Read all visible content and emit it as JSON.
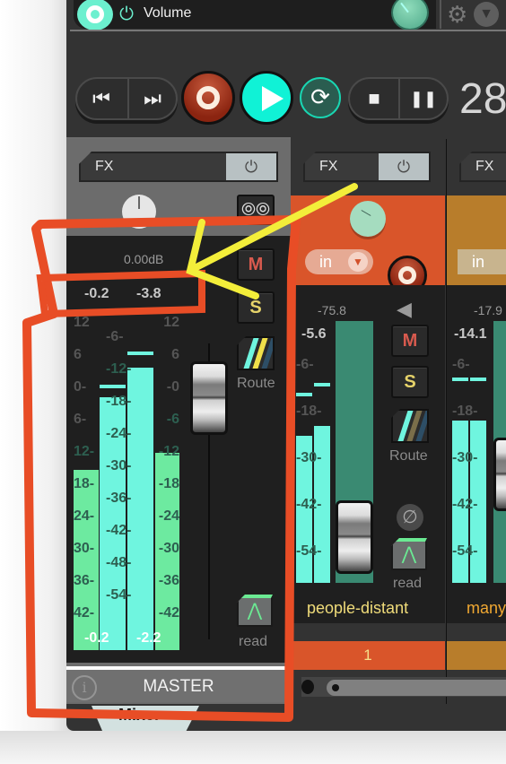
{
  "plugin": {
    "name": "Volume",
    "power_icon": "⏻",
    "gear_icon": "⚙",
    "dropdown_icon": "▼"
  },
  "transport": {
    "prev_icon": "⏮",
    "next_icon": "⏭",
    "record_icon": "record",
    "play_icon": "play",
    "loop_icon": "⟳",
    "stop_icon": "■",
    "pause_icon": "❚❚",
    "counter": "28"
  },
  "master": {
    "fx_label": "FX",
    "fx_power_icon": "⏻",
    "stereo_icon": "⦾⦾",
    "volume_db": "0.00dB",
    "peak_left": "-0.2",
    "peak_right": "-3.8",
    "mute_label": "M",
    "solo_label": "S",
    "route_label": "Route",
    "automation_label": "read",
    "automation_icon": "⋀",
    "name": "MASTER",
    "info_icon": "i",
    "meter_bottom_left": "-0.2",
    "meter_bottom_right": "-2.2",
    "scale_outer_left": [
      "12",
      "6",
      "0-",
      "6-",
      "12-",
      "18-",
      "24-",
      "30-",
      "36-",
      "42-"
    ],
    "scale_outer_right": [
      "12",
      "6",
      "-0",
      "-6",
      "-12",
      "-18",
      "-24",
      "-30",
      "-36",
      "-42"
    ],
    "scale_center": [
      "-6-",
      "-12-",
      "-18-",
      "-24-",
      "-30-",
      "-36-",
      "-42-",
      "-48-",
      "-54-"
    ],
    "meter_levels": {
      "left_rms": 0.55,
      "left_peak": 0.77,
      "right_peak": 0.86,
      "right_rms": 0.6
    },
    "fader_position_db": 0.0
  },
  "tracks": [
    {
      "fx_label": "FX",
      "fx_power_icon": "⏻",
      "input_label": "in",
      "input_arrow": "▼",
      "volume": "-75.8",
      "peak": "-5.6",
      "mute_label": "M",
      "solo_label": "S",
      "route_label": "Route",
      "phase_icon": "∅",
      "automation_label": "read",
      "automation_icon": "⋀",
      "scale": [
        "-6-",
        "-18-",
        "-30-",
        "-42-",
        "-54-"
      ],
      "name": "people-distant",
      "number": "1",
      "color": "#d9552a",
      "name_color": "#f0dc7a"
    },
    {
      "fx_label": "FX",
      "input_label": "in",
      "volume": "-17.9",
      "peak": "-14.1",
      "scale": [
        "-6-",
        "-18-",
        "-30-",
        "-42-",
        "-54-"
      ],
      "name": "many",
      "color": "#b87d2b",
      "name_color": "#f0a832"
    }
  ],
  "bottom_tab": {
    "label": "Mixer"
  },
  "colors": {
    "accent": "#10f2d6",
    "meter": "#6ff5df",
    "meter_green": "#6deaa0",
    "record": "#8b2410"
  }
}
